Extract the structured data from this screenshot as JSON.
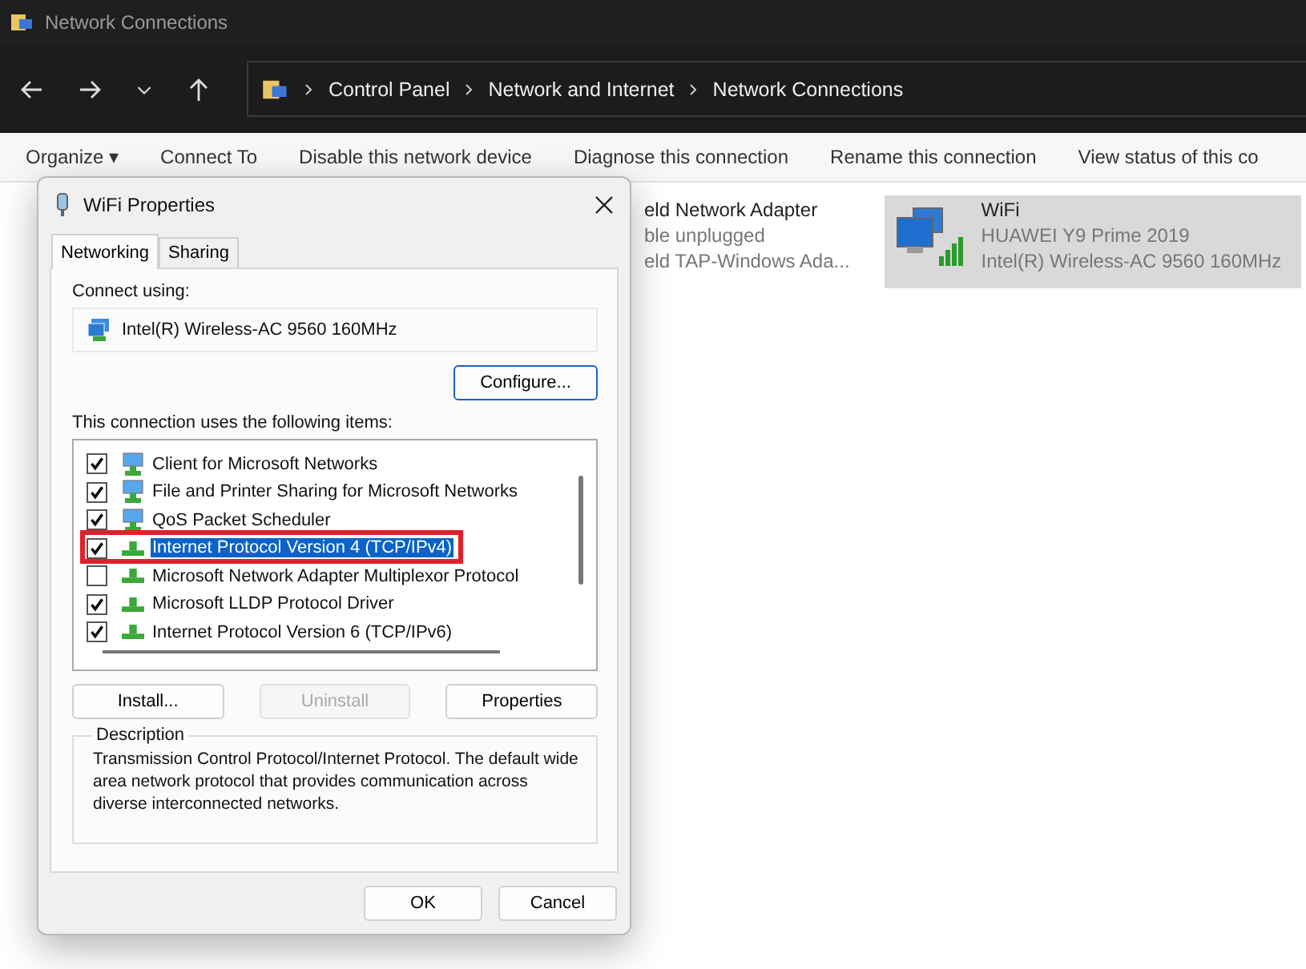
{
  "window": {
    "title": "Network Connections"
  },
  "breadcrumb": [
    "Control Panel",
    "Network and Internet",
    "Network Connections"
  ],
  "toolbar": [
    "Organize ▾",
    "Connect To",
    "Disable this network device",
    "Diagnose this connection",
    "Rename this connection",
    "View status of this co"
  ],
  "adapters": [
    {
      "name": "eld Network Adapter",
      "status": "ble unplugged",
      "device": "eld TAP-Windows Ada...",
      "selected": false,
      "kind": "cut"
    },
    {
      "name": "WiFi",
      "status": "HUAWEI Y9 Prime 2019",
      "device": "Intel(R) Wireless-AC 9560 160MHz",
      "selected": true,
      "kind": "wifi"
    }
  ],
  "dialog": {
    "title": "WiFi Properties",
    "tabs": [
      {
        "label": "Networking",
        "selected": true
      },
      {
        "label": "Sharing",
        "selected": false
      }
    ],
    "connect_using_label": "Connect using:",
    "adapter": "Intel(R) Wireless-AC 9560 160MHz",
    "configure_button": "Configure...",
    "items_label": "This connection uses the following items:",
    "items": [
      {
        "label": "Client for Microsoft Networks",
        "checked": true,
        "selected": false,
        "kind": "service"
      },
      {
        "label": "File and Printer Sharing for Microsoft Networks",
        "checked": true,
        "selected": false,
        "kind": "service"
      },
      {
        "label": "QoS Packet Scheduler",
        "checked": true,
        "selected": false,
        "kind": "service"
      },
      {
        "label": "Internet Protocol Version 4 (TCP/IPv4)",
        "checked": true,
        "selected": true,
        "kind": "protocol"
      },
      {
        "label": "Microsoft Network Adapter Multiplexor Protocol",
        "checked": false,
        "selected": false,
        "kind": "protocol"
      },
      {
        "label": "Microsoft LLDP Protocol Driver",
        "checked": true,
        "selected": false,
        "kind": "protocol"
      },
      {
        "label": "Internet Protocol Version 6 (TCP/IPv6)",
        "checked": true,
        "selected": false,
        "kind": "protocol"
      }
    ],
    "item_buttons": [
      {
        "label": "Install...",
        "disabled": false
      },
      {
        "label": "Uninstall",
        "disabled": true
      },
      {
        "label": "Properties",
        "disabled": false
      }
    ],
    "description_title": "Description",
    "description": "Transmission Control Protocol/Internet Protocol. The default wide area network protocol that provides communication across diverse interconnected networks.",
    "buttons": [
      "OK",
      "Cancel"
    ]
  }
}
